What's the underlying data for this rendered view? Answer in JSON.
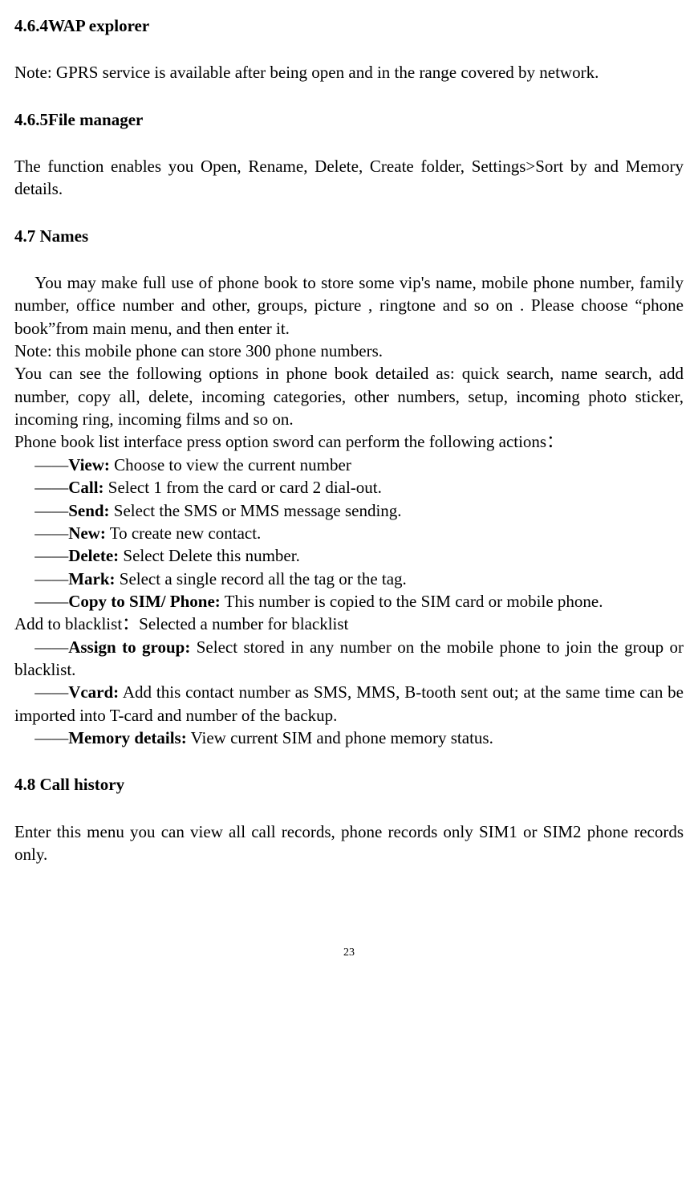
{
  "section_464": {
    "heading": "4.6.4WAP  explorer",
    "body": "Note: GPRS service is available after being open and in the range covered by network."
  },
  "section_465": {
    "heading": "4.6.5File manager",
    "body": "The function enables you Open, Rename, Delete, Create folder, Settings>Sort by and Memory details."
  },
  "section_47": {
    "heading": "4.7 Names",
    "intro1_a": "You may make full use of phone book to store some vip's name, mobile phone number, family number, office number and other, groups, picture , ringtone and so on . Please choose “phone book”from main menu, and then enter it.",
    "intro2": "Note: this mobile phone can store 300 phone numbers.",
    "intro3": "You can see the following options in phone book detailed as: quick search, name search, add number, copy all, delete, incoming categories, other numbers, setup, incoming photo sticker, incoming ring, incoming films and so on.",
    "intro4": "Phone book list interface press option sword can perform the following actions：",
    "options": [
      {
        "prefix": "——",
        "label": "View:",
        "text": " Choose to view the current number"
      },
      {
        "prefix": "——",
        "label": "Call:",
        "text": " Select 1 from the card or card 2 dial-out."
      },
      {
        "prefix": "——",
        "label": "Send:",
        "text": " Select the SMS or MMS message sending."
      },
      {
        "prefix": "——",
        "label": "New:",
        "text": " To create new contact."
      },
      {
        "prefix": "——",
        "label": "Delete:",
        "text": " Select Delete this number."
      },
      {
        "prefix": "——",
        "label": "Mark:",
        "text": " Select a single record all the tag or the tag."
      },
      {
        "prefix": "——",
        "label": "Copy to SIM/ Phone:",
        "text": " This number is copied to the SIM card or mobile phone."
      }
    ],
    "blacklist_line": "Add to blacklist：Selected a number for blacklist",
    "options2": [
      {
        "prefix": "——",
        "label": "Assign to group:",
        "text": " Select stored in any number on the mobile phone to join the group or blacklist."
      },
      {
        "prefix": "——",
        "label": "Vcard:",
        "text": " Add this contact number as SMS, MMS, B-tooth sent out; at the same time can be imported into T-card and number of the backup."
      },
      {
        "prefix": "——",
        "label": "Memory details:",
        "text": " View current SIM and phone memory status."
      }
    ]
  },
  "section_48": {
    "heading": "4.8 Call history",
    "body": "Enter this menu you can view all call records, phone records only SIM1 or SIM2 phone records only."
  },
  "page_number": "23"
}
